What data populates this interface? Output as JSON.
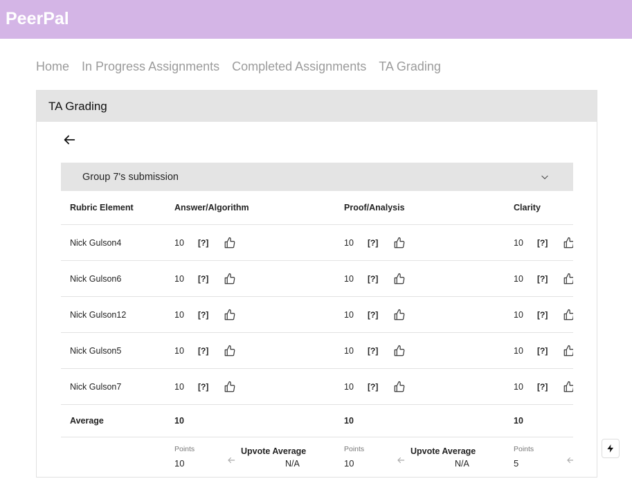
{
  "app": {
    "brand": "PeerPal",
    "accent_color": "#d4b5e6"
  },
  "nav": [
    "Home",
    "In Progress Assignments",
    "Completed Assignments",
    "TA Grading"
  ],
  "card": {
    "title": "TA Grading"
  },
  "submission": {
    "title": "Group 7's submission"
  },
  "rubric": {
    "columns": [
      "Rubric Element",
      "Answer/Algorithm",
      "Proof/Analysis",
      "Clarity"
    ],
    "rows": [
      {
        "name": "Nick Gulson4",
        "scores": [
          "10",
          "10",
          "10"
        ]
      },
      {
        "name": "Nick Gulson6",
        "scores": [
          "10",
          "10",
          "10"
        ]
      },
      {
        "name": "Nick Gulson12",
        "scores": [
          "10",
          "10",
          "10"
        ]
      },
      {
        "name": "Nick Gulson5",
        "scores": [
          "10",
          "10",
          "10"
        ]
      },
      {
        "name": "Nick Gulson7",
        "scores": [
          "10",
          "10",
          "10"
        ]
      }
    ],
    "help_label": "[?]",
    "average": {
      "label": "Average",
      "values": [
        "10",
        "10",
        "10"
      ]
    },
    "points_label": "Points",
    "upvote_label": "Upvote Average",
    "points": [
      "10",
      "10",
      "5"
    ],
    "upvote_averages": [
      "N/A",
      "N/A"
    ]
  },
  "icons": {
    "back": "arrow-left-icon",
    "expand": "chevron-down-icon",
    "like": "thumbs-up-icon",
    "dev": "lightning-icon"
  }
}
